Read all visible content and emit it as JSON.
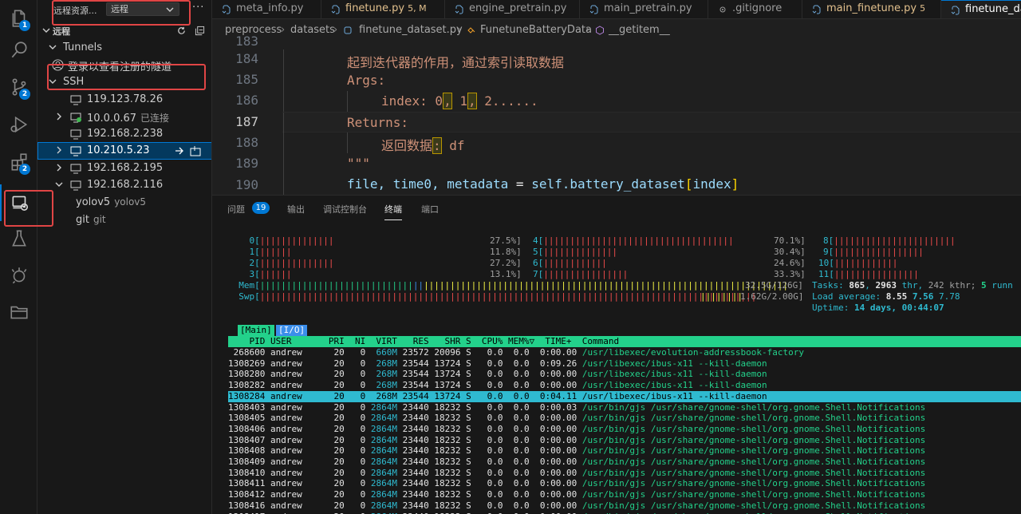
{
  "activity_bar": {
    "items": [
      {
        "name": "explorer-icon",
        "badge": "1"
      },
      {
        "name": "search-icon",
        "badge": ""
      },
      {
        "name": "source-control-icon",
        "badge": "2"
      },
      {
        "name": "run-debug-icon",
        "badge": ""
      },
      {
        "name": "extensions-icon",
        "badge": "2"
      },
      {
        "name": "remote-explorer-icon",
        "badge": ""
      },
      {
        "name": "testing-icon",
        "badge": ""
      },
      {
        "name": "anaconda-icon",
        "badge": ""
      },
      {
        "name": "folder-icon",
        "badge": ""
      }
    ]
  },
  "sidebar": {
    "title": "远程资源...",
    "select_value": "远程",
    "more": "···",
    "section_label": "远程",
    "tunnels_label": "Tunnels",
    "tunnels_message": "登录以查看注册的隧道",
    "ssh_label": "SSH",
    "hosts": [
      {
        "label": "119.123.78.26",
        "desc": "",
        "expandable": false,
        "connected": false
      },
      {
        "label": "10.0.0.67",
        "desc": "已连接",
        "expandable": true,
        "connected": true
      },
      {
        "label": "192.168.2.238",
        "desc": "",
        "expandable": false,
        "connected": false
      },
      {
        "label": "10.210.5.23",
        "desc": "",
        "expandable": true,
        "connected": false
      },
      {
        "label": "192.168.2.195",
        "desc": "",
        "expandable": true,
        "connected": false
      },
      {
        "label": "192.168.2.116",
        "desc": "",
        "expandable": true,
        "connected": false
      }
    ],
    "sub_items": [
      {
        "label": "yolov5",
        "desc": "yolov5"
      },
      {
        "label": "git",
        "desc": "git"
      }
    ]
  },
  "editor": {
    "tabs": [
      {
        "label": "meta_info.py",
        "mod": ""
      },
      {
        "label": "finetune.py",
        "mod": "5, M"
      },
      {
        "label": "engine_pretrain.py",
        "mod": ""
      },
      {
        "label": "main_pretrain.py",
        "mod": ""
      },
      {
        "label": ".gitignore",
        "mod": ""
      },
      {
        "label": "main_finetune.py",
        "mod": "5"
      },
      {
        "label": "finetune_da",
        "mod": ""
      }
    ],
    "breadcrumbs": [
      "preprocess",
      "datasets",
      "finetune_dataset.py",
      "FunetuneBatteryData",
      "__getitem__"
    ],
    "line_numbers": [
      "183",
      "184",
      "185",
      "186",
      "187",
      "188",
      "189",
      "190"
    ],
    "current_line": "187",
    "code": {
      "l184": "起到迭代器的作用，通过索引读取数据",
      "l185": "Args:",
      "l186_a": "index: 0",
      "l186_b": ",",
      "l186_c": " 1",
      "l186_d": ",",
      "l186_e": " 2......",
      "l187": "Returns:",
      "l188_a": "返回数据",
      "l188_b": ":",
      "l188_c": " df",
      "l189": "\"\"\"",
      "l190_a": "file, time0, metadata",
      "l190_b": " = ",
      "l190_c": "self.battery_dataset",
      "l190_d": "[",
      "l190_e": "index",
      "l190_f": "]"
    }
  },
  "panel": {
    "tabs": [
      "问题",
      "输出",
      "调试控制台",
      "终端",
      "端口"
    ],
    "problems_count": "19",
    "active_tab": "终端"
  },
  "terminal": {
    "cpu_rows": [
      {
        "a": "    0[",
        "a_bar": "||||||||||||||",
        "a_pct": "27.5%]",
        "b": "4[",
        "b_bar": "||||||||||||||||||||||||||||||||||||",
        "b_pct": "70.1%]",
        "c": "8[",
        "c_bar": "|||||||||||||||||||||||"
      },
      {
        "a": "    1[",
        "a_bar": "||||||",
        "a_pct": "11.8%]",
        "b": "5[",
        "b_bar": "||||||||||||||",
        "b_pct": "30.4%]",
        "c": "9[",
        "c_bar": "|||||||||||||||||"
      },
      {
        "a": "    2[",
        "a_bar": "||||||||||||||",
        "a_pct": "27.2%]",
        "b": "6[",
        "b_bar": "||||||||||||",
        "b_pct": "24.6%]",
        "c": "10[",
        "c_bar": "||||||||||||"
      },
      {
        "a": "    3[",
        "a_bar": "||||||",
        "a_pct": "13.1%]",
        "b": "7[",
        "b_bar": "||||||||||||||||",
        "b_pct": "33.3%]",
        "c": "11[",
        "c_bar": "||||||||||||||||"
      }
    ],
    "mem_label": "  Mem[",
    "mem_bar_green": "|||||||||||||||||||||||||||||",
    "mem_bar_blue": "||",
    "mem_bar_yellow": "|||||||||||||||||||||||||||||||||||||||||||||||||||||||||||||||||||||",
    "mem_value": "32.5G/126G]",
    "swp_label": "  Swp[",
    "swp_bar_red": "||||||||||||||||||||||||||||||||||||||||||||||||||||||||||||||||||||||||||||||||||||||||||||||",
    "swp_bar_yellow": "||||||||",
    "swp_value": "1.62G/2.00G]",
    "tasks_label": "Tasks: ",
    "tasks_val": "865",
    "tasks_sep": ", ",
    "thr_val": "2963",
    "thr_label": " thr, ",
    "kthr": "242 kthr; ",
    "running": "5",
    "running_label": " runn",
    "load_label": "Load average: ",
    "load1": "8.55",
    "load5": "7.56",
    "load15": "7.78",
    "uptime_label": "Uptime: ",
    "uptime": "14 days, 00:44:07",
    "tab_main": "[Main]",
    "tab_io": "[I/O]",
    "header": "    PID USER       PRI  NI  VIRT   RES   SHR S  CPU% MEM%▽  TIME+  Command",
    "procs": [
      {
        "pid": "268600",
        "user": "andrew",
        "pri": "20",
        "ni": "0",
        "virt": "660M",
        "res": "23572",
        "shr": "20096",
        "s": "S",
        "cpu": "0.0",
        "mem": "0.0",
        "time": "0:00.00",
        "cmd": "/usr/libexec/evolution-addressbook-factory",
        "hl": false
      },
      {
        "pid": "1308269",
        "user": "andrew",
        "pri": "20",
        "ni": "0",
        "virt": "268M",
        "res": "23544",
        "shr": "13724",
        "s": "S",
        "cpu": "0.0",
        "mem": "0.0",
        "time": "0:09.26",
        "cmd": "/usr/libexec/ibus-x11 --kill-daemon",
        "hl": false
      },
      {
        "pid": "1308280",
        "user": "andrew",
        "pri": "20",
        "ni": "0",
        "virt": "268M",
        "res": "23544",
        "shr": "13724",
        "s": "S",
        "cpu": "0.0",
        "mem": "0.0",
        "time": "0:00.00",
        "cmd": "/usr/libexec/ibus-x11 --kill-daemon",
        "hl": false
      },
      {
        "pid": "1308282",
        "user": "andrew",
        "pri": "20",
        "ni": "0",
        "virt": "268M",
        "res": "23544",
        "shr": "13724",
        "s": "S",
        "cpu": "0.0",
        "mem": "0.0",
        "time": "0:00.00",
        "cmd": "/usr/libexec/ibus-x11 --kill-daemon",
        "hl": false
      },
      {
        "pid": "1308284",
        "user": "andrew",
        "pri": "20",
        "ni": "0",
        "virt": "268M",
        "res": "23544",
        "shr": "13724",
        "s": "S",
        "cpu": "0.0",
        "mem": "0.0",
        "time": "0:04.11",
        "cmd": "/usr/libexec/ibus-x11 --kill-daemon",
        "hl": true
      },
      {
        "pid": "1308403",
        "user": "andrew",
        "pri": "20",
        "ni": "0",
        "virt": "2864M",
        "res": "23440",
        "shr": "18232",
        "s": "S",
        "cpu": "0.0",
        "mem": "0.0",
        "time": "0:00.03",
        "cmd": "/usr/bin/gjs /usr/share/gnome-shell/org.gnome.Shell.Notifications",
        "hl": false
      },
      {
        "pid": "1308405",
        "user": "andrew",
        "pri": "20",
        "ni": "0",
        "virt": "2864M",
        "res": "23440",
        "shr": "18232",
        "s": "S",
        "cpu": "0.0",
        "mem": "0.0",
        "time": "0:00.00",
        "cmd": "/usr/bin/gjs /usr/share/gnome-shell/org.gnome.Shell.Notifications",
        "hl": false
      },
      {
        "pid": "1308406",
        "user": "andrew",
        "pri": "20",
        "ni": "0",
        "virt": "2864M",
        "res": "23440",
        "shr": "18232",
        "s": "S",
        "cpu": "0.0",
        "mem": "0.0",
        "time": "0:00.00",
        "cmd": "/usr/bin/gjs /usr/share/gnome-shell/org.gnome.Shell.Notifications",
        "hl": false
      },
      {
        "pid": "1308407",
        "user": "andrew",
        "pri": "20",
        "ni": "0",
        "virt": "2864M",
        "res": "23440",
        "shr": "18232",
        "s": "S",
        "cpu": "0.0",
        "mem": "0.0",
        "time": "0:00.00",
        "cmd": "/usr/bin/gjs /usr/share/gnome-shell/org.gnome.Shell.Notifications",
        "hl": false
      },
      {
        "pid": "1308408",
        "user": "andrew",
        "pri": "20",
        "ni": "0",
        "virt": "2864M",
        "res": "23440",
        "shr": "18232",
        "s": "S",
        "cpu": "0.0",
        "mem": "0.0",
        "time": "0:00.00",
        "cmd": "/usr/bin/gjs /usr/share/gnome-shell/org.gnome.Shell.Notifications",
        "hl": false
      },
      {
        "pid": "1308409",
        "user": "andrew",
        "pri": "20",
        "ni": "0",
        "virt": "2864M",
        "res": "23440",
        "shr": "18232",
        "s": "S",
        "cpu": "0.0",
        "mem": "0.0",
        "time": "0:00.00",
        "cmd": "/usr/bin/gjs /usr/share/gnome-shell/org.gnome.Shell.Notifications",
        "hl": false
      },
      {
        "pid": "1308410",
        "user": "andrew",
        "pri": "20",
        "ni": "0",
        "virt": "2864M",
        "res": "23440",
        "shr": "18232",
        "s": "S",
        "cpu": "0.0",
        "mem": "0.0",
        "time": "0:00.00",
        "cmd": "/usr/bin/gjs /usr/share/gnome-shell/org.gnome.Shell.Notifications",
        "hl": false
      },
      {
        "pid": "1308411",
        "user": "andrew",
        "pri": "20",
        "ni": "0",
        "virt": "2864M",
        "res": "23440",
        "shr": "18232",
        "s": "S",
        "cpu": "0.0",
        "mem": "0.0",
        "time": "0:00.00",
        "cmd": "/usr/bin/gjs /usr/share/gnome-shell/org.gnome.Shell.Notifications",
        "hl": false
      },
      {
        "pid": "1308412",
        "user": "andrew",
        "pri": "20",
        "ni": "0",
        "virt": "2864M",
        "res": "23440",
        "shr": "18232",
        "s": "S",
        "cpu": "0.0",
        "mem": "0.0",
        "time": "0:00.00",
        "cmd": "/usr/bin/gjs /usr/share/gnome-shell/org.gnome.Shell.Notifications",
        "hl": false
      },
      {
        "pid": "1308416",
        "user": "andrew",
        "pri": "20",
        "ni": "0",
        "virt": "2864M",
        "res": "23440",
        "shr": "18232",
        "s": "S",
        "cpu": "0.0",
        "mem": "0.0",
        "time": "0:00.00",
        "cmd": "/usr/bin/gjs /usr/share/gnome-shell/org.gnome.Shell.Notifications",
        "hl": false
      },
      {
        "pid": "1308417",
        "user": "andrew",
        "pri": "20",
        "ni": "0",
        "virt": "2864M",
        "res": "23440",
        "shr": "18232",
        "s": "S",
        "cpu": "0.0",
        "mem": "0.0",
        "time": "0:00.00",
        "cmd": "/usr/bin/gjs /usr/share/gnome-shell/org.gnome.Shell.Notifications",
        "hl": false
      }
    ]
  },
  "colors": {
    "accent": "#0078d4",
    "annotation": "#e04545",
    "htop_header": "#23d18b",
    "htop_selected": "#2fbad0"
  }
}
